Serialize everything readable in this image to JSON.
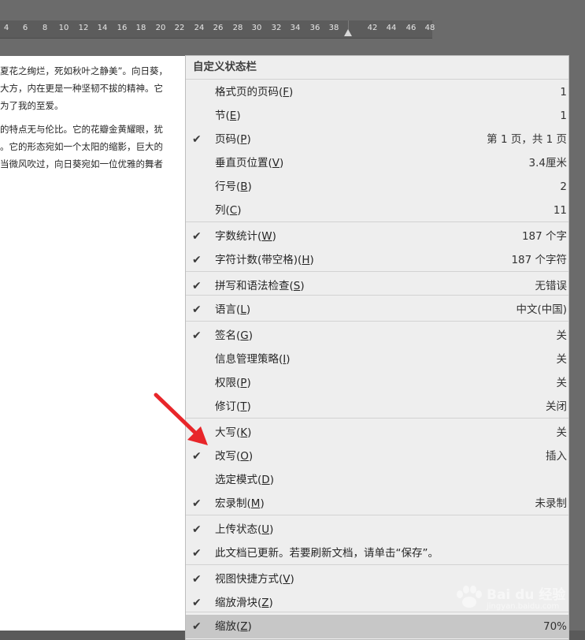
{
  "ruler": {
    "ticks": [
      "4",
      "6",
      "8",
      "10",
      "12",
      "14",
      "16",
      "18",
      "20",
      "22",
      "24",
      "26",
      "28",
      "30",
      "32",
      "34",
      "36",
      "38",
      "42",
      "44",
      "46",
      "48"
    ]
  },
  "document": {
    "lines": [
      "夏花之绚烂，死如秋叶之静美”。向日葵，",
      "大方，内在更是一种坚韧不拔的精神。它",
      "为了我的至爱。",
      "的特点无与伦比。它的花瓣金黄耀眼，犹",
      "。它的形态宛如一个太阳的缩影，巨大的",
      "当微风吹过，向日葵宛如一位优雅的舞者"
    ]
  },
  "menu": {
    "title": "自定义状态栏",
    "items": [
      {
        "checked": false,
        "label": "格式页的页码",
        "key": "F",
        "value": "1"
      },
      {
        "checked": false,
        "label": "节",
        "key": "E",
        "value": "1"
      },
      {
        "checked": true,
        "label": "页码",
        "key": "P",
        "value": "第 1 页，共 1 页"
      },
      {
        "checked": false,
        "label": "垂直页位置",
        "key": "V",
        "value": "3.4厘米"
      },
      {
        "checked": false,
        "label": "行号",
        "key": "B",
        "value": "2"
      },
      {
        "checked": false,
        "label": "列",
        "key": "C",
        "value": "11"
      },
      {
        "checked": true,
        "label": "字数统计",
        "key": "W",
        "value": "187 个字"
      },
      {
        "checked": true,
        "label": "字符计数(带空格)",
        "key": "H",
        "value": "187 个字符"
      },
      {
        "checked": true,
        "label": "拼写和语法检查",
        "key": "S",
        "value": "无错误"
      },
      {
        "checked": true,
        "label": "语言",
        "key": "L",
        "value": "中文(中国)"
      },
      {
        "checked": true,
        "label": "签名",
        "key": "G",
        "value": "关"
      },
      {
        "checked": false,
        "label": "信息管理策略",
        "key": "I",
        "value": "关"
      },
      {
        "checked": false,
        "label": "权限",
        "key": "P",
        "value": "关"
      },
      {
        "checked": false,
        "label": "修订",
        "key": "T",
        "value": "关闭"
      },
      {
        "checked": false,
        "label": "大写",
        "key": "K",
        "value": "关"
      },
      {
        "checked": true,
        "label": "改写",
        "key": "O",
        "value": "插入"
      },
      {
        "checked": false,
        "label": "选定模式",
        "key": "D",
        "value": ""
      },
      {
        "checked": true,
        "label": "宏录制",
        "key": "M",
        "value": "未录制"
      },
      {
        "checked": true,
        "label": "上传状态",
        "key": "U",
        "value": ""
      },
      {
        "checked": true,
        "label": "此文档已更新。若要刷新文档，请单击“保存”。",
        "key": "",
        "value": ""
      },
      {
        "checked": true,
        "label": "视图快捷方式",
        "key": "V",
        "value": ""
      },
      {
        "checked": true,
        "label": "缩放滑块",
        "key": "Z",
        "value": ""
      },
      {
        "checked": true,
        "label": "缩放",
        "key": "Z",
        "value": "70%",
        "highlighted": true
      }
    ]
  },
  "check_glyph": "✔",
  "watermark": {
    "text": "Bai du 经验",
    "sub": "jingyan.baidu.com"
  },
  "colors": {
    "arrow": "#e8262a",
    "menu_bg": "#eeeeee",
    "highlight": "#c7c7c7"
  }
}
